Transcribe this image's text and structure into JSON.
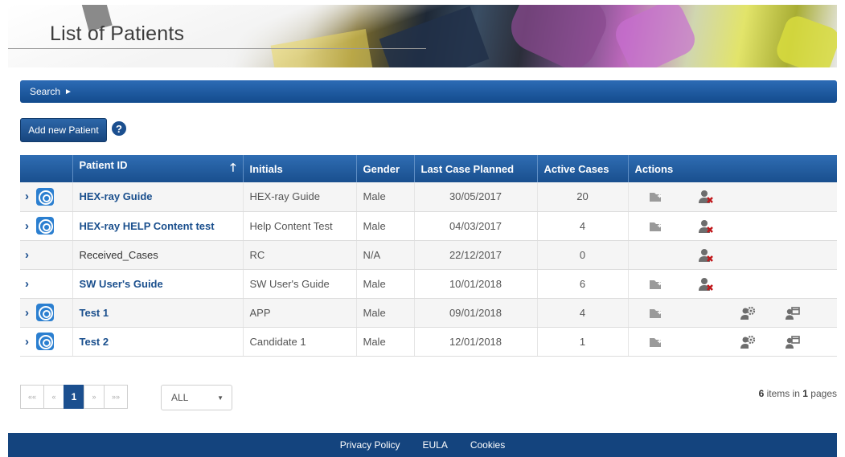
{
  "banner": {
    "title": "List of Patients"
  },
  "search": {
    "label": "Search",
    "arrow": "►"
  },
  "toolbar": {
    "add_label": "Add new Patient",
    "help_glyph": "?"
  },
  "table": {
    "headers": [
      "",
      "Patient ID",
      "Initials",
      "Gender",
      "Last Case Planned",
      "Active Cases",
      "Actions"
    ],
    "sort_glyph": "🡑",
    "rows": [
      {
        "id": "HEX-ray Guide",
        "initials": "HEX-ray Guide",
        "gender": "Male",
        "last_case": "30/05/2017",
        "active": "20",
        "link": true,
        "case_icon": true,
        "actions": [
          "folder-arrow-icon",
          "user-delete-icon"
        ]
      },
      {
        "id": "HEX-ray HELP Content test",
        "initials": "Help Content Test",
        "gender": "Male",
        "last_case": "04/03/2017",
        "active": "4",
        "link": true,
        "case_icon": true,
        "actions": [
          "folder-arrow-icon",
          "user-delete-icon"
        ]
      },
      {
        "id": "Received_Cases",
        "initials": "RC",
        "gender": "N/A",
        "last_case": "22/12/2017",
        "active": "0",
        "link": false,
        "case_icon": false,
        "actions": [
          "user-delete-icon"
        ]
      },
      {
        "id": "SW User's Guide",
        "initials": "SW User's Guide",
        "gender": "Male",
        "last_case": "10/01/2018",
        "active": "6",
        "link": true,
        "case_icon": false,
        "actions": [
          "folder-arrow-icon",
          "user-delete-icon"
        ]
      },
      {
        "id": "Test 1",
        "initials": "APP",
        "gender": "Male",
        "last_case": "09/01/2018",
        "active": "4",
        "link": true,
        "case_icon": true,
        "actions": [
          "folder-arrow-icon",
          "user-settings-icon",
          "user-calendar-icon"
        ]
      },
      {
        "id": "Test 2",
        "initials": "Candidate 1",
        "gender": "Male",
        "last_case": "12/01/2018",
        "active": "1",
        "link": true,
        "case_icon": true,
        "actions": [
          "folder-arrow-icon",
          "user-settings-icon",
          "user-calendar-icon"
        ]
      }
    ]
  },
  "pagination": {
    "first": "««",
    "prev": "«",
    "current": "1",
    "next": "»",
    "last": "»»",
    "page_size": "ALL",
    "caret": "▼",
    "items_count": "6",
    "items_text": " items in ",
    "pages_count": "1",
    "pages_text": " pages"
  },
  "footer": {
    "links": [
      "Privacy Policy",
      "EULA",
      "Cookies"
    ]
  },
  "colors": {
    "primary": "#1b4f8f",
    "footer": "#14447e",
    "link": "#1a4f8d"
  }
}
